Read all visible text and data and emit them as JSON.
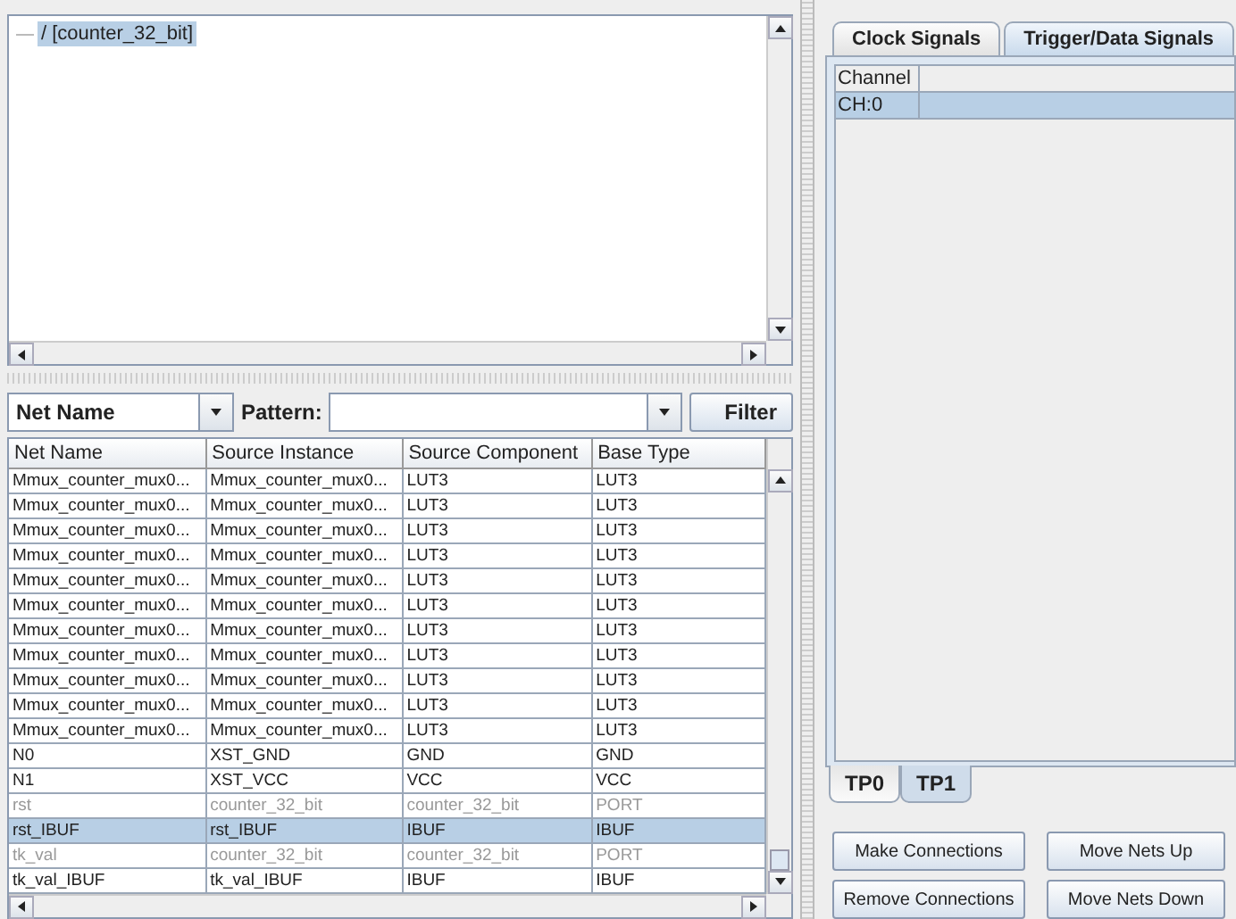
{
  "tree": {
    "items": [
      {
        "label": "/ [counter_32_bit]",
        "selected": true
      }
    ]
  },
  "filter": {
    "field": "Net Name",
    "pattern_label": "Pattern:",
    "button": "Filter"
  },
  "table": {
    "columns": [
      "Net Name",
      "Source Instance",
      "Source Component",
      "Base Type"
    ],
    "rows": [
      {
        "cells": [
          "Mmux_counter_mux0...",
          "Mmux_counter_mux0...",
          "LUT3",
          "LUT3"
        ],
        "disabled": false,
        "selected": false
      },
      {
        "cells": [
          "Mmux_counter_mux0...",
          "Mmux_counter_mux0...",
          "LUT3",
          "LUT3"
        ],
        "disabled": false,
        "selected": false
      },
      {
        "cells": [
          "Mmux_counter_mux0...",
          "Mmux_counter_mux0...",
          "LUT3",
          "LUT3"
        ],
        "disabled": false,
        "selected": false
      },
      {
        "cells": [
          "Mmux_counter_mux0...",
          "Mmux_counter_mux0...",
          "LUT3",
          "LUT3"
        ],
        "disabled": false,
        "selected": false
      },
      {
        "cells": [
          "Mmux_counter_mux0...",
          "Mmux_counter_mux0...",
          "LUT3",
          "LUT3"
        ],
        "disabled": false,
        "selected": false
      },
      {
        "cells": [
          "Mmux_counter_mux0...",
          "Mmux_counter_mux0...",
          "LUT3",
          "LUT3"
        ],
        "disabled": false,
        "selected": false
      },
      {
        "cells": [
          "Mmux_counter_mux0...",
          "Mmux_counter_mux0...",
          "LUT3",
          "LUT3"
        ],
        "disabled": false,
        "selected": false
      },
      {
        "cells": [
          "Mmux_counter_mux0...",
          "Mmux_counter_mux0...",
          "LUT3",
          "LUT3"
        ],
        "disabled": false,
        "selected": false
      },
      {
        "cells": [
          "Mmux_counter_mux0...",
          "Mmux_counter_mux0...",
          "LUT3",
          "LUT3"
        ],
        "disabled": false,
        "selected": false
      },
      {
        "cells": [
          "Mmux_counter_mux0...",
          "Mmux_counter_mux0...",
          "LUT3",
          "LUT3"
        ],
        "disabled": false,
        "selected": false
      },
      {
        "cells": [
          "Mmux_counter_mux0...",
          "Mmux_counter_mux0...",
          "LUT3",
          "LUT3"
        ],
        "disabled": false,
        "selected": false
      },
      {
        "cells": [
          "N0",
          "XST_GND",
          "GND",
          "GND"
        ],
        "disabled": false,
        "selected": false
      },
      {
        "cells": [
          "N1",
          "XST_VCC",
          "VCC",
          "VCC"
        ],
        "disabled": false,
        "selected": false
      },
      {
        "cells": [
          "rst",
          "counter_32_bit",
          "counter_32_bit",
          "PORT"
        ],
        "disabled": true,
        "selected": false
      },
      {
        "cells": [
          "rst_IBUF",
          "rst_IBUF",
          "IBUF",
          "IBUF"
        ],
        "disabled": false,
        "selected": true
      },
      {
        "cells": [
          "tk_val",
          "counter_32_bit",
          "counter_32_bit",
          "PORT"
        ],
        "disabled": true,
        "selected": false
      },
      {
        "cells": [
          "tk_val_IBUF",
          "tk_val_IBUF",
          "IBUF",
          "IBUF"
        ],
        "disabled": false,
        "selected": false
      }
    ]
  },
  "signal_tabs": [
    {
      "label": "Clock Signals",
      "selected": false
    },
    {
      "label": "Trigger/Data Signals",
      "selected": true
    }
  ],
  "channels": {
    "column": "Channel",
    "rows": [
      {
        "label": "CH:0",
        "selected": true
      }
    ]
  },
  "trigger_tabs": [
    {
      "label": "TP0",
      "selected": false
    },
    {
      "label": "TP1",
      "selected": true
    }
  ],
  "buttons": [
    "Make Connections",
    "Move Nets Up",
    "Remove Connections",
    "Move Nets Down"
  ]
}
